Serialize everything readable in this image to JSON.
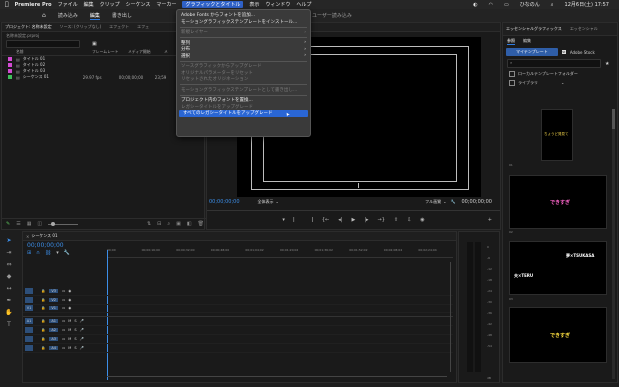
{
  "menubar": {
    "apple": "",
    "app_name": "Premiere Pro",
    "items": [
      "ファイル",
      "編集",
      "クリップ",
      "シーケンス",
      "マーカー",
      "グラフィックとタイトル",
      "表示",
      "ウィンドウ",
      "ヘルプ"
    ],
    "status": {
      "user": "ひなのん",
      "datetime": "12月6日(土) 17:57"
    }
  },
  "workspace": {
    "home": "⌂",
    "tabs": [
      "読み込み",
      "編集",
      "書き出し"
    ],
    "active_tab": "編集",
    "right_label": "ユーザー読み込み",
    "doc_title": "名称未設定"
  },
  "project": {
    "tabs": [
      "プロジェクト: 名称未設定",
      "ソース: (クリップなし)",
      "エフェクト",
      "エフェ"
    ],
    "path": "名称未設定.prproj",
    "count": "4 個のアイテム",
    "headers": [
      "名前",
      "フレームレート",
      "メディア開始",
      "メ"
    ],
    "items": [
      {
        "name": "タイトル 01",
        "rate": "",
        "start": "",
        "end": "",
        "color": "#d24bd2"
      },
      {
        "name": "タイトル 02",
        "rate": "",
        "start": "",
        "end": "",
        "color": "#d24bd2"
      },
      {
        "name": "タイトル 03",
        "rate": "",
        "start": "",
        "end": "",
        "color": "#d24bd2"
      },
      {
        "name": "シーケンス 01",
        "rate": "29.97 fps",
        "start": "00;00;00;00",
        "end": "23;59",
        "color": "#3fbf5a"
      }
    ]
  },
  "menu": {
    "items": [
      {
        "label": "Adobe Fonts からフォントを追加...",
        "state": "enabled",
        "arrow": false
      },
      {
        "label": "モーショングラフィックステンプレートをインストール...",
        "state": "enabled",
        "arrow": false
      },
      {
        "sep": true
      },
      {
        "label": "新規レイヤー",
        "state": "disabled",
        "arrow": true
      },
      {
        "sep": true
      },
      {
        "label": "整列",
        "state": "enabled",
        "arrow": true
      },
      {
        "label": "分布",
        "state": "enabled",
        "arrow": true
      },
      {
        "label": "選択",
        "state": "enabled",
        "arrow": true
      },
      {
        "sep": true
      },
      {
        "label": "ソースグラフィックからアップグレード",
        "state": "disabled",
        "arrow": false
      },
      {
        "label": "オリジナルパラメーターをリセット",
        "state": "disabled",
        "arrow": false
      },
      {
        "label": "リセットされたオリジネーション",
        "state": "disabled",
        "arrow": false
      },
      {
        "sep": true
      },
      {
        "label": "モーショングラフィックステンプレートとして書き出し...",
        "state": "disabled",
        "arrow": false
      },
      {
        "sep": true
      },
      {
        "label": "プロジェクト内のフォントを置換...",
        "state": "enabled",
        "arrow": false
      },
      {
        "label": "レガシータイトルをアップグレード",
        "state": "disabled",
        "arrow": false
      },
      {
        "label": "すべてのレガシータイトルをアップグレード",
        "state": "selected",
        "arrow": false
      }
    ]
  },
  "program": {
    "timecode": "00;00;00;00",
    "fit": "全体表示",
    "quality": "フル画質",
    "end_timecode": "00;00;00;00"
  },
  "timeline": {
    "tab": "シーケンス 01",
    "timecode": "00;00;00;00",
    "ruler": [
      "00;00",
      "00;00;16;00",
      "00;00;32;00",
      "00;00;48;00",
      "00;01;04;02",
      "00;01;20;02",
      "00;01;36;02",
      "00;01;52;02",
      "00;02;08;04",
      "00;02;24;04"
    ],
    "video_tracks": [
      "V3",
      "V2",
      "V1"
    ],
    "audio_tracks": [
      "A1",
      "A2",
      "A3",
      "A4"
    ],
    "letters": {
      "lock": "6",
      "m": "M",
      "s": "S"
    }
  },
  "meter": {
    "labels": [
      "0",
      "-6",
      "-12",
      "-18",
      "-24",
      "-30",
      "-36",
      "-42",
      "-48",
      "-54"
    ],
    "footer": "dB"
  },
  "essential": {
    "title": "エッセンシャルグラフィックス",
    "tab2": "エッセンシャル",
    "sub_tabs": [
      "参照",
      "編集"
    ],
    "my_templates": "マイテンプレート",
    "adobe_stock": "Adobe Stock",
    "cb1": "ローカルテンプレートフォルダー",
    "cb2": "ライブラリ",
    "templates": [
      {
        "text": "ちょうど発見て",
        "color": "#f2d34a"
      },
      {
        "text": "できすぎ",
        "color": "#ff66cc"
      },
      {
        "text": "夢×TSUKASA",
        "color": "#ffffff"
      },
      {
        "text": "夫×TERU",
        "color": "#ffffff"
      },
      {
        "text": "できすぎ",
        "color": "#ffe040"
      }
    ]
  }
}
